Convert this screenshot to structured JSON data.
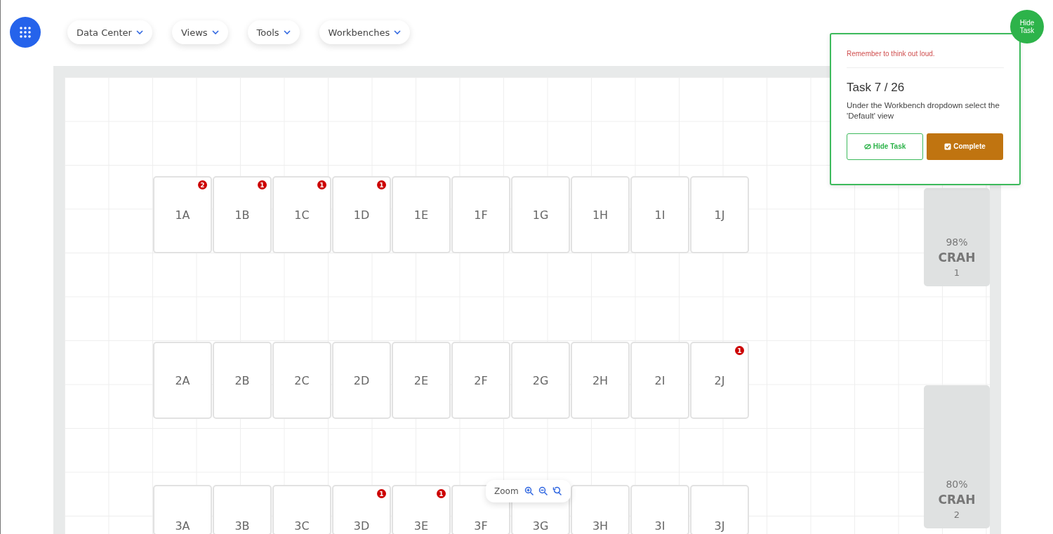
{
  "nav_menus": [
    {
      "label": "Data Center"
    },
    {
      "label": "Views"
    },
    {
      "label": "Tools"
    },
    {
      "label": "Workbenches"
    }
  ],
  "rack_rows": [
    {
      "racks": [
        {
          "label": "1A",
          "badge": "2"
        },
        {
          "label": "1B",
          "badge": "1"
        },
        {
          "label": "1C",
          "badge": "1"
        },
        {
          "label": "1D",
          "badge": "1"
        },
        {
          "label": "1E"
        },
        {
          "label": "1F"
        },
        {
          "label": "1G"
        },
        {
          "label": "1H"
        },
        {
          "label": "1I"
        },
        {
          "label": "1J"
        }
      ]
    },
    {
      "racks": [
        {
          "label": "2A"
        },
        {
          "label": "2B"
        },
        {
          "label": "2C"
        },
        {
          "label": "2D"
        },
        {
          "label": "2E"
        },
        {
          "label": "2F"
        },
        {
          "label": "2G"
        },
        {
          "label": "2H"
        },
        {
          "label": "2I"
        },
        {
          "label": "2J",
          "badge": "1"
        }
      ]
    },
    {
      "racks": [
        {
          "label": "3A"
        },
        {
          "label": "3B"
        },
        {
          "label": "3C"
        },
        {
          "label": "3D",
          "badge": "1"
        },
        {
          "label": "3E",
          "badge": "1"
        },
        {
          "label": "3F"
        },
        {
          "label": "3G"
        },
        {
          "label": "3H"
        },
        {
          "label": "3I"
        },
        {
          "label": "3J"
        }
      ]
    }
  ],
  "crah_units": [
    {
      "percent": "98%",
      "name": "CRAH",
      "number": "1"
    },
    {
      "percent": "80%",
      "name": "CRAH",
      "number": "2"
    }
  ],
  "zoom_control": {
    "label": "Zoom"
  },
  "task_panel": {
    "toggle": "Hide Task",
    "reminder": "Remember to think out loud.",
    "title": "Task 7 / 26",
    "description": "Under the Workbench dropdown select the 'Default' view",
    "buttons": [
      {
        "kind": "outline",
        "label": "Hide Task"
      },
      {
        "kind": "primary",
        "label": "Complete"
      }
    ]
  }
}
